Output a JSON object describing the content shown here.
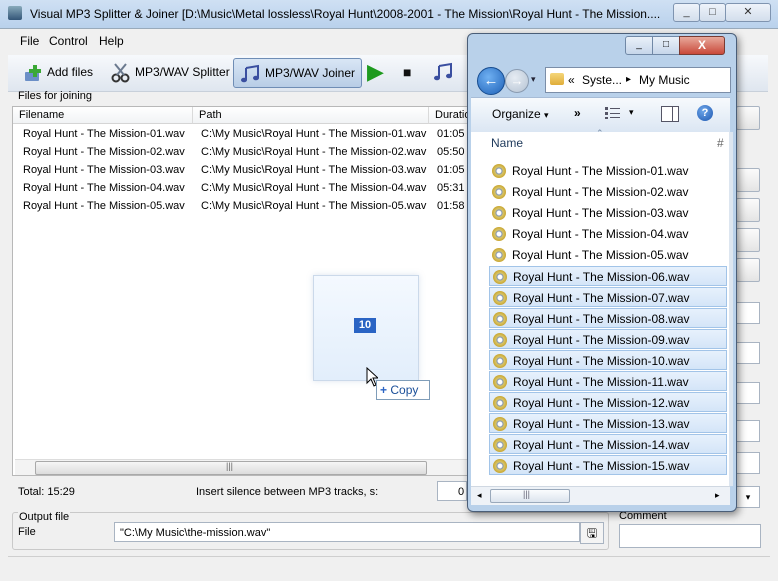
{
  "app": {
    "title": "Visual MP3 Splitter & Joiner [D:\\Music\\Metal lossless\\Royal Hunt\\2008-2001 - The Mission\\Royal Hunt - The Mission....",
    "minimize_glyph": "_",
    "maximize_glyph": "□",
    "close_glyph": "✕"
  },
  "menu": {
    "file": "File",
    "control": "Control",
    "help": "Help"
  },
  "toolbar": {
    "add_files": "Add files",
    "splitter": "MP3/WAV Splitter",
    "joiner": "MP3/WAV Joiner",
    "play_glyph": "▶",
    "stop_glyph": "■"
  },
  "files_section": {
    "label": "Files for joining",
    "columns": {
      "filename": "Filename",
      "path": "Path",
      "duration": "Duratio"
    },
    "rows": [
      {
        "filename": "Royal Hunt - The Mission-01.wav",
        "path": "C:\\My Music\\Royal Hunt - The Mission-01.wav",
        "duration": "01:05"
      },
      {
        "filename": "Royal Hunt - The Mission-02.wav",
        "path": "C:\\My Music\\Royal Hunt - The Mission-02.wav",
        "duration": "05:50"
      },
      {
        "filename": "Royal Hunt - The Mission-03.wav",
        "path": "C:\\My Music\\Royal Hunt - The Mission-03.wav",
        "duration": "01:05"
      },
      {
        "filename": "Royal Hunt - The Mission-04.wav",
        "path": "C:\\My Music\\Royal Hunt - The Mission-04.wav",
        "duration": "05:31"
      },
      {
        "filename": "Royal Hunt - The Mission-05.wav",
        "path": "C:\\My Music\\Royal Hunt - The Mission-05.wav",
        "duration": "01:58"
      }
    ],
    "scroll_grip": "|||"
  },
  "total": "Total: 15:29",
  "silence": {
    "label": "Insert silence between MP3 tracks, s:",
    "value": "0"
  },
  "output": {
    "group_label": "Output file",
    "file_label": "File",
    "file_value": "\"C:\\My Music\\the-mission.wav\"",
    "browse_glyph": "🖫",
    "comment_label": "Comment"
  },
  "drag": {
    "count": "10",
    "copy_label": "Copy",
    "copy_glyph": "+"
  },
  "explorer": {
    "min_glyph": "_",
    "max_glyph": "□",
    "close_glyph": "X",
    "back_glyph": "←",
    "forward_glyph": "→",
    "history_glyph": "▾",
    "address_overflow": "«",
    "address_parent": "Syste...",
    "address_sep": "▸",
    "address_current": "My Music",
    "organize": "Organize",
    "organize_arrow": "▾",
    "more_glyph": "»",
    "views_arrow": "▾",
    "help_glyph": "?",
    "column_name": "Name",
    "column_hash": "#",
    "scroll_grip": "|||",
    "scroll_left": "◂",
    "scroll_right": "▸",
    "items": [
      {
        "name": "Royal Hunt - The Mission-01.wav",
        "selected": false
      },
      {
        "name": "Royal Hunt - The Mission-02.wav",
        "selected": false
      },
      {
        "name": "Royal Hunt - The Mission-03.wav",
        "selected": false
      },
      {
        "name": "Royal Hunt - The Mission-04.wav",
        "selected": false
      },
      {
        "name": "Royal Hunt - The Mission-05.wav",
        "selected": false
      },
      {
        "name": "Royal Hunt - The Mission-06.wav",
        "selected": true
      },
      {
        "name": "Royal Hunt - The Mission-07.wav",
        "selected": true
      },
      {
        "name": "Royal Hunt - The Mission-08.wav",
        "selected": true
      },
      {
        "name": "Royal Hunt - The Mission-09.wav",
        "selected": true
      },
      {
        "name": "Royal Hunt - The Mission-10.wav",
        "selected": true
      },
      {
        "name": "Royal Hunt - The Mission-11.wav",
        "selected": true
      },
      {
        "name": "Royal Hunt - The Mission-12.wav",
        "selected": true
      },
      {
        "name": "Royal Hunt - The Mission-13.wav",
        "selected": true
      },
      {
        "name": "Royal Hunt - The Mission-14.wav",
        "selected": true
      },
      {
        "name": "Royal Hunt - The Mission-15.wav",
        "selected": true
      }
    ]
  }
}
